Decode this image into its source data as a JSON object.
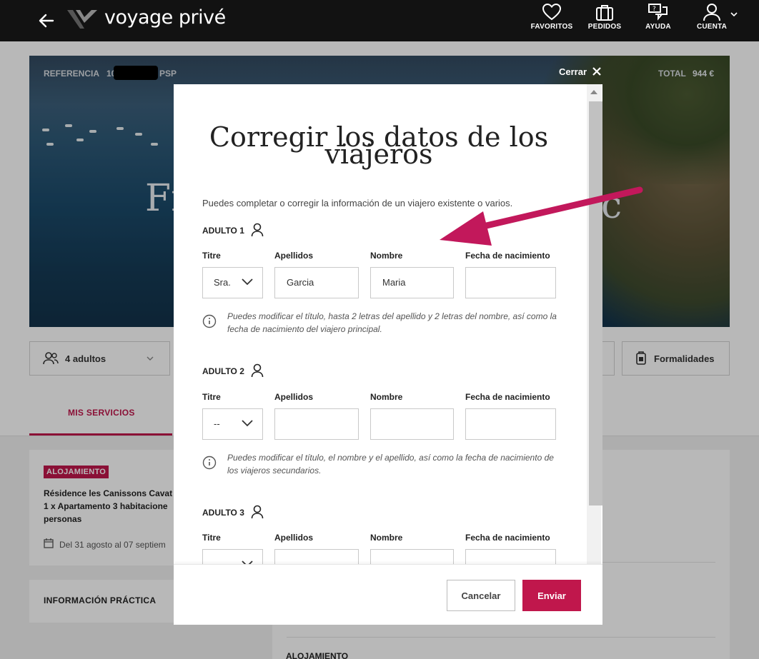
{
  "topnav": {
    "logo_text": "voyage privé",
    "items": [
      {
        "label": "FAVORITOS"
      },
      {
        "label": "PEDIDOS"
      },
      {
        "label": "AYUDA"
      },
      {
        "label": "CUENTA"
      }
    ]
  },
  "hero": {
    "reference_label": "REFERENCIA",
    "reference_value_visible_prefix": "10",
    "reference_value_visible_suffix": "PSP",
    "total_label": "TOTAL",
    "total_value": "944 €",
    "title_fragment_left": "Fr",
    "title_fragment_right": "c"
  },
  "filters": {
    "travellers": "4 adultos",
    "formalities": "Formalidades"
  },
  "tabs": {
    "active": "MIS SERVICIOS"
  },
  "service_card": {
    "badge": "ALOJAMIENTO",
    "line1": "Résidence les Canissons Cavat",
    "line2": "1 x Apartamento 3 habitacione",
    "line3": "personas",
    "dates": "Del 31 agosto al 07 septiem"
  },
  "info_card": {
    "title": "INFORMACIÓN PRÁCTICA"
  },
  "bottom_label": "ALOJAMIENTO",
  "modal": {
    "close_label": "Cerrar",
    "title": "Corregir los datos de los viajeros",
    "intro": "Puedes completar o corregir la información de un viajero existente o varios.",
    "column_labels": {
      "title": "Titre",
      "surname": "Apellidos",
      "name": "Nombre",
      "birthdate": "Fecha de nacimiento"
    },
    "travellers": [
      {
        "heading": "ADULTO 1",
        "title_value": "Sra.",
        "surname_value": "Garcia",
        "name_value": "Maria",
        "birthdate_value": "",
        "note": "Puedes modificar el título, hasta 2 letras del apellido y 2 letras del nombre, así como la fecha de nacimiento del viajero principal."
      },
      {
        "heading": "ADULTO 2",
        "title_value": "--",
        "surname_value": "",
        "name_value": "",
        "birthdate_value": "",
        "note": "Puedes modificar el título, el nombre y el apellido, así como la fecha de nacimiento de los viajeros secundarios."
      },
      {
        "heading": "ADULTO 3",
        "title_value": "",
        "surname_value": "",
        "name_value": "",
        "birthdate_value": ""
      }
    ],
    "buttons": {
      "cancel": "Cancelar",
      "submit": "Enviar"
    }
  },
  "colors": {
    "brand": "#c0174c",
    "nav_bg": "#121212",
    "annotation_arrow": "#c2185b"
  },
  "icons": [
    "back-arrow-icon",
    "logo-v-icon",
    "heart-icon",
    "bag-icon",
    "chat-icon",
    "user-icon",
    "chevron-down-icon",
    "close-icon",
    "person-icon",
    "info-icon",
    "users-icon",
    "passport-icon",
    "calendar-icon"
  ]
}
